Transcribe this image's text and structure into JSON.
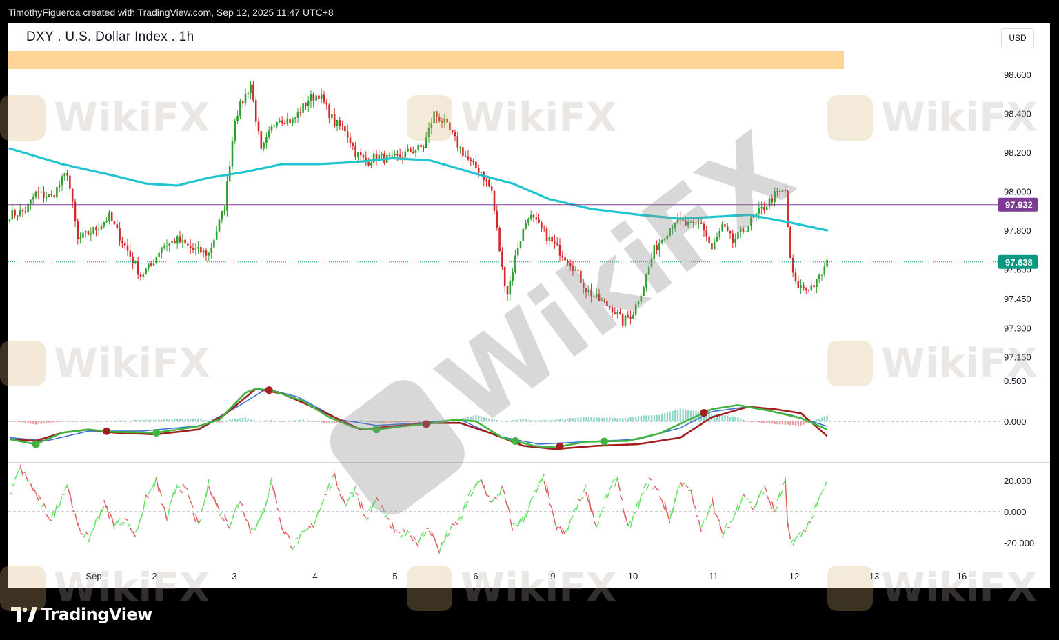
{
  "header": {
    "created_by": "TimothyFigueroa created with TradingView.com, Sep 12, 2025 11:47 UTC+8"
  },
  "chart_title": "DXY . U.S. Dollar Index . 1h",
  "currency": "USD",
  "branding": {
    "logo_text": "TradingView",
    "watermark_text": "WikiFX"
  },
  "colors": {
    "up": "#2ca02c",
    "down": "#d62728",
    "ma": "#22c4d0",
    "band": "#ffd597",
    "hline": "#7e3b94",
    "current_price_bg": "#089981",
    "hline_label_bg": "#7e3b94",
    "macd_fast": "#3fb43f",
    "macd_slow_blue": "#3d6fd8",
    "macd_signal": "#a31f1f",
    "osc_up": "#66e066",
    "osc_down": "#e06060"
  },
  "chart_data": [
    {
      "type": "candlestick",
      "title": "DXY . U.S. Dollar Index . 1h",
      "ylim": [
        97.05,
        98.72
      ],
      "y_ticks": [
        "98.600",
        "98.400",
        "98.200",
        "98.000",
        "97.800",
        "97.600",
        "97.450",
        "97.300",
        "97.150"
      ],
      "x_ticks": [
        "Sep",
        "2",
        "3",
        "4",
        "5",
        "6",
        "9",
        "10",
        "11",
        "12",
        "13",
        "16"
      ],
      "horizontal_line_label": "97.932",
      "current_price_label": "97.638",
      "anchors": [
        [
          0,
          97.88
        ],
        [
          6,
          97.9
        ],
        [
          10,
          97.99
        ],
        [
          16,
          97.97
        ],
        [
          22,
          98.1
        ],
        [
          26,
          97.75
        ],
        [
          32,
          97.8
        ],
        [
          38,
          97.87
        ],
        [
          44,
          97.72
        ],
        [
          50,
          97.57
        ],
        [
          54,
          97.62
        ],
        [
          58,
          97.72
        ],
        [
          64,
          97.75
        ],
        [
          70,
          97.7
        ],
        [
          76,
          97.68
        ],
        [
          82,
          97.92
        ],
        [
          86,
          98.38
        ],
        [
          92,
          98.55
        ],
        [
          96,
          98.2
        ],
        [
          102,
          98.38
        ],
        [
          108,
          98.36
        ],
        [
          114,
          98.47
        ],
        [
          118,
          98.5
        ],
        [
          124,
          98.35
        ],
        [
          128,
          98.32
        ],
        [
          132,
          98.2
        ],
        [
          136,
          98.15
        ],
        [
          140,
          98.18
        ],
        [
          146,
          98.16
        ],
        [
          152,
          98.2
        ],
        [
          158,
          98.23
        ],
        [
          162,
          98.4
        ],
        [
          166,
          98.35
        ],
        [
          172,
          98.22
        ],
        [
          176,
          98.14
        ],
        [
          180,
          98.1
        ],
        [
          184,
          98.0
        ],
        [
          188,
          97.6
        ],
        [
          190,
          97.48
        ],
        [
          194,
          97.72
        ],
        [
          198,
          97.88
        ],
        [
          202,
          97.82
        ],
        [
          208,
          97.72
        ],
        [
          214,
          97.64
        ],
        [
          220,
          97.5
        ],
        [
          224,
          97.45
        ],
        [
          230,
          97.4
        ],
        [
          234,
          97.33
        ],
        [
          238,
          97.38
        ],
        [
          242,
          97.52
        ],
        [
          246,
          97.7
        ],
        [
          250,
          97.78
        ],
        [
          254,
          97.85
        ],
        [
          260,
          97.82
        ],
        [
          264,
          97.84
        ],
        [
          268,
          97.7
        ],
        [
          272,
          97.82
        ],
        [
          276,
          97.74
        ],
        [
          280,
          97.8
        ],
        [
          284,
          97.86
        ],
        [
          288,
          97.92
        ],
        [
          292,
          97.98
        ],
        [
          296,
          98.0
        ],
        [
          298,
          97.64
        ],
        [
          300,
          97.52
        ],
        [
          304,
          97.5
        ],
        [
          308,
          97.53
        ],
        [
          312,
          97.63
        ]
      ],
      "ma_line": [
        [
          0,
          98.22
        ],
        [
          20,
          98.14
        ],
        [
          40,
          98.08
        ],
        [
          52,
          98.04
        ],
        [
          64,
          98.03
        ],
        [
          76,
          98.07
        ],
        [
          90,
          98.1
        ],
        [
          104,
          98.14
        ],
        [
          118,
          98.14
        ],
        [
          132,
          98.15
        ],
        [
          146,
          98.17
        ],
        [
          160,
          98.16
        ],
        [
          168,
          98.13
        ],
        [
          178,
          98.09
        ],
        [
          192,
          98.04
        ],
        [
          206,
          97.96
        ],
        [
          222,
          97.91
        ],
        [
          240,
          97.88
        ],
        [
          256,
          97.86
        ],
        [
          270,
          97.87
        ],
        [
          282,
          97.88
        ],
        [
          298,
          97.84
        ],
        [
          312,
          97.8
        ]
      ]
    },
    {
      "type": "line",
      "name": "oscillator-1",
      "ylim": [
        -0.5,
        0.55
      ],
      "y_ticks": [
        "0.500",
        "0.000"
      ],
      "fast_line": [
        [
          0,
          -0.22
        ],
        [
          10,
          -0.28
        ],
        [
          20,
          -0.14
        ],
        [
          30,
          -0.1
        ],
        [
          40,
          -0.13
        ],
        [
          56,
          -0.14
        ],
        [
          72,
          -0.06
        ],
        [
          80,
          0.02
        ],
        [
          90,
          0.35
        ],
        [
          94,
          0.4
        ],
        [
          100,
          0.38
        ],
        [
          112,
          0.25
        ],
        [
          122,
          0.05
        ],
        [
          132,
          -0.08
        ],
        [
          140,
          -0.1
        ],
        [
          150,
          -0.06
        ],
        [
          160,
          -0.03
        ],
        [
          170,
          0.02
        ],
        [
          178,
          0.0
        ],
        [
          188,
          -0.2
        ],
        [
          200,
          -0.3
        ],
        [
          208,
          -0.32
        ],
        [
          220,
          -0.25
        ],
        [
          236,
          -0.24
        ],
        [
          248,
          -0.15
        ],
        [
          258,
          0.0
        ],
        [
          268,
          0.15
        ],
        [
          278,
          0.2
        ],
        [
          290,
          0.13
        ],
        [
          302,
          0.04
        ],
        [
          312,
          -0.1
        ]
      ],
      "slow_line": [
        [
          0,
          -0.2
        ],
        [
          14,
          -0.24
        ],
        [
          30,
          -0.12
        ],
        [
          50,
          -0.12
        ],
        [
          74,
          -0.05
        ],
        [
          88,
          0.2
        ],
        [
          98,
          0.4
        ],
        [
          110,
          0.3
        ],
        [
          126,
          0.02
        ],
        [
          140,
          -0.05
        ],
        [
          156,
          -0.02
        ],
        [
          172,
          0.02
        ],
        [
          186,
          -0.18
        ],
        [
          202,
          -0.28
        ],
        [
          220,
          -0.25
        ],
        [
          240,
          -0.22
        ],
        [
          256,
          -0.08
        ],
        [
          268,
          0.12
        ],
        [
          282,
          0.18
        ],
        [
          298,
          0.08
        ],
        [
          312,
          -0.06
        ]
      ],
      "signal_line": [
        [
          0,
          -0.22
        ],
        [
          10,
          -0.24
        ],
        [
          20,
          -0.14
        ],
        [
          30,
          -0.1
        ],
        [
          40,
          -0.14
        ],
        [
          56,
          -0.16
        ],
        [
          72,
          -0.1
        ],
        [
          82,
          0.08
        ],
        [
          94,
          0.4
        ],
        [
          104,
          0.34
        ],
        [
          114,
          0.2
        ],
        [
          124,
          0.05
        ],
        [
          134,
          -0.1
        ],
        [
          146,
          -0.06
        ],
        [
          162,
          -0.02
        ],
        [
          172,
          -0.02
        ],
        [
          184,
          -0.15
        ],
        [
          196,
          -0.3
        ],
        [
          208,
          -0.34
        ],
        [
          224,
          -0.3
        ],
        [
          240,
          -0.28
        ],
        [
          256,
          -0.2
        ],
        [
          268,
          0.05
        ],
        [
          282,
          0.18
        ],
        [
          292,
          0.15
        ],
        [
          302,
          0.1
        ],
        [
          312,
          -0.18
        ]
      ],
      "cross_markers": [
        {
          "i": 10,
          "color": "up"
        },
        {
          "i": 37,
          "color": "down"
        },
        {
          "i": 56,
          "color": "up"
        },
        {
          "i": 99,
          "color": "down"
        },
        {
          "i": 140,
          "color": "up"
        },
        {
          "i": 159,
          "color": "down"
        },
        {
          "i": 193,
          "color": "up"
        },
        {
          "i": 210,
          "color": "down"
        },
        {
          "i": 227,
          "color": "up"
        },
        {
          "i": 265,
          "color": "down"
        }
      ]
    },
    {
      "type": "line",
      "name": "oscillator-2",
      "ylim": [
        -32,
        32
      ],
      "y_ticks": [
        "20.000",
        "0.000",
        "-20.000"
      ],
      "anchors": [
        [
          0,
          10
        ],
        [
          4,
          28
        ],
        [
          8,
          18
        ],
        [
          12,
          5
        ],
        [
          16,
          -5
        ],
        [
          22,
          18
        ],
        [
          26,
          -10
        ],
        [
          30,
          -18
        ],
        [
          36,
          5
        ],
        [
          40,
          -8
        ],
        [
          44,
          -5
        ],
        [
          48,
          -15
        ],
        [
          52,
          8
        ],
        [
          56,
          20
        ],
        [
          60,
          -5
        ],
        [
          64,
          18
        ],
        [
          68,
          12
        ],
        [
          72,
          -10
        ],
        [
          76,
          18
        ],
        [
          80,
          0
        ],
        [
          84,
          -8
        ],
        [
          88,
          8
        ],
        [
          92,
          -12
        ],
        [
          96,
          -5
        ],
        [
          100,
          20
        ],
        [
          104,
          -10
        ],
        [
          108,
          -22
        ],
        [
          112,
          -15
        ],
        [
          116,
          -8
        ],
        [
          120,
          10
        ],
        [
          124,
          22
        ],
        [
          128,
          5
        ],
        [
          132,
          15
        ],
        [
          136,
          -5
        ],
        [
          140,
          8
        ],
        [
          144,
          -5
        ],
        [
          148,
          -15
        ],
        [
          152,
          -12
        ],
        [
          156,
          -20
        ],
        [
          160,
          -10
        ],
        [
          164,
          -25
        ],
        [
          168,
          -12
        ],
        [
          172,
          -5
        ],
        [
          176,
          12
        ],
        [
          180,
          20
        ],
        [
          184,
          5
        ],
        [
          188,
          15
        ],
        [
          192,
          -10
        ],
        [
          196,
          -5
        ],
        [
          200,
          10
        ],
        [
          204,
          22
        ],
        [
          208,
          -8
        ],
        [
          212,
          -15
        ],
        [
          216,
          2
        ],
        [
          220,
          15
        ],
        [
          224,
          -10
        ],
        [
          228,
          10
        ],
        [
          232,
          22
        ],
        [
          236,
          -12
        ],
        [
          240,
          5
        ],
        [
          244,
          20
        ],
        [
          248,
          12
        ],
        [
          252,
          -5
        ],
        [
          256,
          20
        ],
        [
          260,
          12
        ],
        [
          264,
          -12
        ],
        [
          268,
          8
        ],
        [
          272,
          -15
        ],
        [
          276,
          -5
        ],
        [
          280,
          12
        ],
        [
          284,
          2
        ],
        [
          288,
          15
        ],
        [
          292,
          0
        ],
        [
          296,
          20
        ],
        [
          297,
          -10
        ],
        [
          298,
          -20
        ],
        [
          302,
          -15
        ],
        [
          306,
          -5
        ],
        [
          310,
          12
        ],
        [
          312,
          18
        ]
      ]
    }
  ]
}
